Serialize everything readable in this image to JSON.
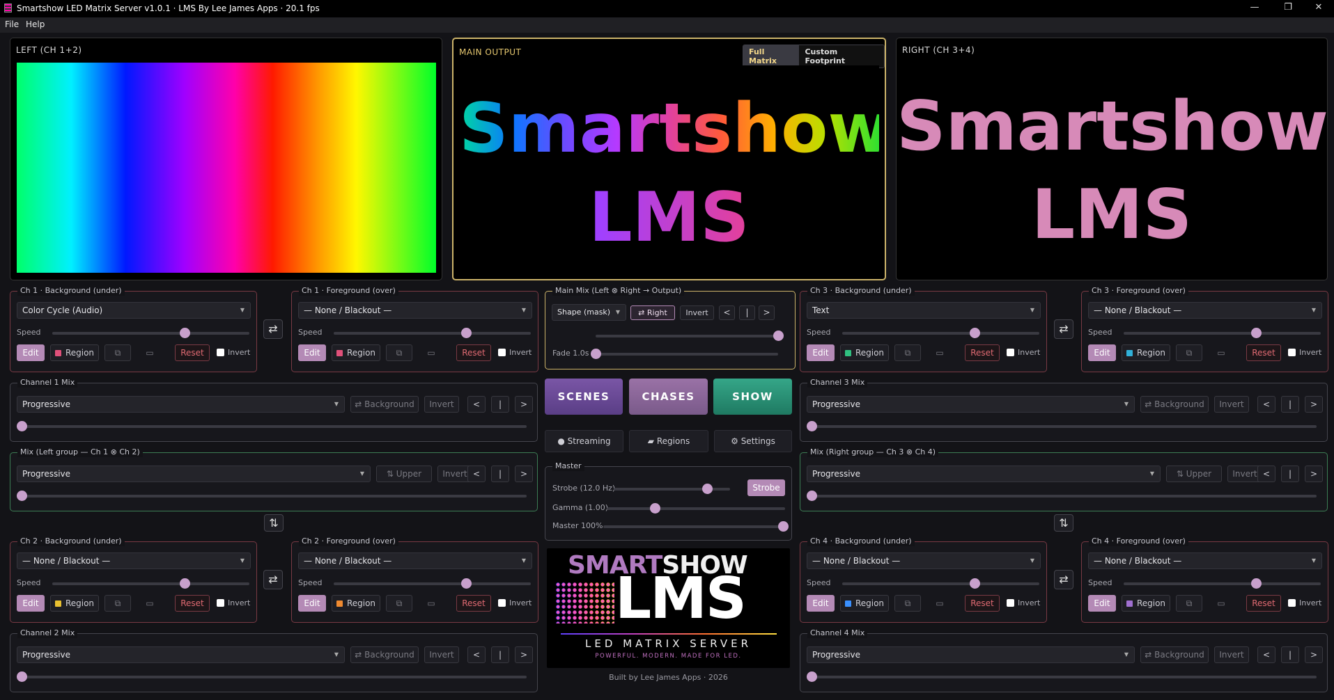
{
  "window": {
    "title": "Smartshow LED Matrix Server v1.0.1 · LMS By Lee James Apps · 20.1 fps",
    "minimize": "—",
    "maximize": "❐",
    "close": "✕"
  },
  "menu": {
    "file": "File",
    "help": "Help"
  },
  "previews": {
    "left": {
      "label": "LEFT (CH 1+2)"
    },
    "main": {
      "label": "MAIN OUTPUT",
      "full": "Full Matrix",
      "custom": "Custom Footprint",
      "line1": "Smartshow",
      "line2": "LMS"
    },
    "right": {
      "label": "RIGHT (CH 3+4)",
      "line1": "Smartshow",
      "line2": "LMS"
    }
  },
  "common": {
    "speed": "Speed",
    "edit": "Edit",
    "region": "Region",
    "reset": "Reset",
    "invert": "Invert",
    "background": "⇄ Background",
    "upper": "⇅ Upper",
    "prev": "<",
    "mid": "|",
    "next": ">",
    "swap": "⇄",
    "vswap": "⇅"
  },
  "ch1bg": {
    "title": "Ch 1 · Background (under)",
    "value": "Color Cycle (Audio)",
    "speed": 0.67,
    "swatch": "#e0507a"
  },
  "ch1fg": {
    "title": "Ch 1 · Foreground (over)",
    "value": "— None / Blackout —",
    "speed": 0.67,
    "swatch": "#e0507a"
  },
  "ch2bg": {
    "title": "Ch 2 · Background (under)",
    "value": "— None / Blackout —",
    "speed": 0.67,
    "swatch": "#e8c030"
  },
  "ch2fg": {
    "title": "Ch 2 · Foreground (over)",
    "value": "— None / Blackout —",
    "speed": 0.67,
    "swatch": "#f08a30"
  },
  "ch3bg": {
    "title": "Ch 3 · Background (under)",
    "value": "Text",
    "speed": 0.67,
    "swatch": "#30c080"
  },
  "ch3fg": {
    "title": "Ch 3 · Foreground (over)",
    "value": "— None / Blackout —",
    "speed": 0.67,
    "swatch": "#30b0d8"
  },
  "ch4bg": {
    "title": "Ch 4 · Background (under)",
    "value": "— None / Blackout —",
    "speed": 0.67,
    "swatch": "#3a90ff"
  },
  "ch4fg": {
    "title": "Ch 4 · Foreground (over)",
    "value": "— None / Blackout —",
    "speed": 0.67,
    "swatch": "#a070d0"
  },
  "ch1mix": {
    "title": "Channel 1 Mix",
    "value": "Progressive",
    "pos": 0
  },
  "ch2mix": {
    "title": "Channel 2 Mix",
    "value": "Progressive",
    "pos": 0
  },
  "ch3mix": {
    "title": "Channel 3 Mix",
    "value": "Progressive",
    "pos": 0
  },
  "ch4mix": {
    "title": "Channel 4 Mix",
    "value": "Progressive",
    "pos": 0
  },
  "leftmix": {
    "title": "Mix (Left group — Ch 1 ⊗ Ch 2)",
    "value": "Progressive",
    "pos": 0
  },
  "rightmix": {
    "title": "Mix (Right group — Ch 3 ⊗ Ch 4)",
    "value": "Progressive",
    "pos": 0
  },
  "mainmix": {
    "title": "Main Mix (Left ⊗ Right → Output)",
    "value": "Shape (mask)",
    "right": "⇄ Right",
    "invert": "Invert",
    "pos": 1
  },
  "nav": {
    "scenes": "SCENES",
    "chases": "CHASES",
    "show": "SHOW",
    "streaming": "Streaming",
    "regions": "Regions",
    "settings": "Settings"
  },
  "master": {
    "title": "Master",
    "strobe_label": "Strobe (12.0 Hz)",
    "strobe_btn": "Strobe",
    "strobe": 0.8,
    "gamma_label": "Gamma (1.00)",
    "gamma": 0.27,
    "master_label": "Master 100%",
    "master": 1
  },
  "logo": {
    "top1": "SMART",
    "top2": "SHOW",
    "big": "LMS",
    "sub": "LED MATRIX SERVER",
    "tag": "POWERFUL. MODERN. MADE FOR LED."
  },
  "footer": "Built by Lee James Apps · 2026"
}
